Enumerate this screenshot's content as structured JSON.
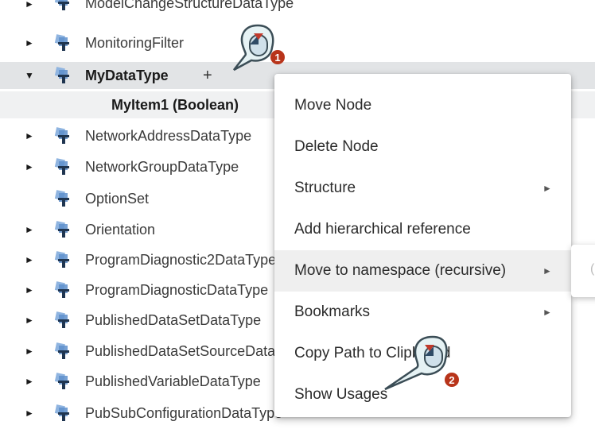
{
  "tree": {
    "rows": [
      {
        "label": "ModelChangeStructureDataType",
        "expander": "►"
      },
      {
        "label": "MonitoringFilter",
        "expander": "►"
      },
      {
        "label": "MyDataType",
        "expander": "▼",
        "action": "+"
      },
      {
        "label": "MyItem1 (Boolean)"
      },
      {
        "label": "NetworkAddressDataType",
        "expander": "►"
      },
      {
        "label": "NetworkGroupDataType",
        "expander": "►"
      },
      {
        "label": "OptionSet"
      },
      {
        "label": "Orientation",
        "expander": "►"
      },
      {
        "label": "ProgramDiagnostic2DataType",
        "expander": "►"
      },
      {
        "label": "ProgramDiagnosticDataType",
        "expander": "►"
      },
      {
        "label": "PublishedDataSetDataType",
        "expander": "►"
      },
      {
        "label": "PublishedDataSetSourceDataType",
        "expander": "►"
      },
      {
        "label": "PublishedVariableDataType",
        "expander": "►"
      },
      {
        "label": "PubSubConfigurationDataType",
        "expander": "►"
      }
    ]
  },
  "context_menu": {
    "items": [
      {
        "label": "Move Node"
      },
      {
        "label": "Delete Node"
      },
      {
        "label": "Structure",
        "submenu": "►"
      },
      {
        "label": "Add hierarchical reference"
      },
      {
        "label": "Move to namespace (recursive)",
        "submenu": "►"
      },
      {
        "label": "Bookmarks",
        "submenu": "►"
      },
      {
        "label": "Copy Path to Clipboard"
      },
      {
        "label": "Show Usages"
      }
    ]
  },
  "submenu_peek": {
    "glyph": "("
  },
  "callouts": [
    {
      "number": "1"
    },
    {
      "number": "2"
    }
  ],
  "colors": {
    "icon_blue": "#7ea7d8",
    "icon_dark": "#1f3550",
    "badge": "#b8341a",
    "callout_fill": "#e6f2f4",
    "callout_stroke": "#3b4d56"
  }
}
